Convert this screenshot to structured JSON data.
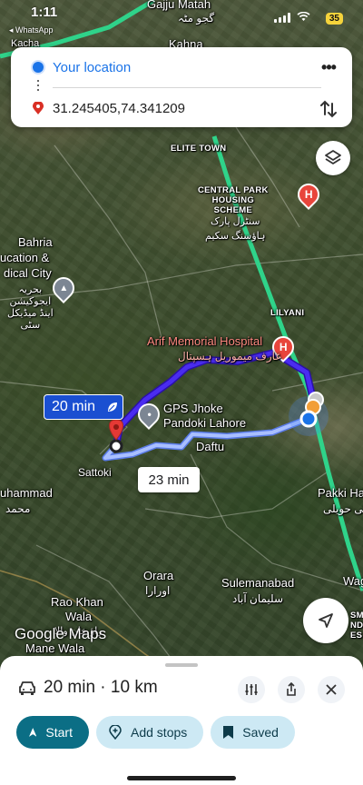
{
  "status_bar": {
    "time": "1:11",
    "back_label": "◂ WhatsApp",
    "battery": "35"
  },
  "directions": {
    "origin": "Your location",
    "destination": "31.245405,74.341209",
    "more_label": "•••"
  },
  "map": {
    "labels": {
      "kacha": "Kacha",
      "gajju_matah": "Gajju Matah",
      "gajju_matah_urdu": "گجو مٹہ",
      "kahna": "Kahna",
      "elite_town": "ELITE TOWN",
      "central_park": "CENTRAL PARK\nHOUSING\nSCHEME",
      "central_park_urdu": "سنٹرل پارک\nہاؤسنگ سکیم",
      "bahria_1": "Bahria",
      "bahria_2": "ucation &",
      "bahria_3": "dical City",
      "bahria_urdu": "بحریہ\nایجوکیشن\nاینڈ میڈیکل\nسٹی",
      "lilyani": "LILYANI",
      "arif_hospital": "Arif Memorial Hospital",
      "arif_hospital_urdu": "عارف میموریل ہسپتال",
      "gps": "GPS Jhoke\nPandoki Lahore",
      "daftu": "Daftu",
      "sattoki": "Sattoki",
      "muhammad": "uhammad",
      "muhammad_urdu": "محمد",
      "pakki": "Pakki Hav",
      "pakki_urdu": "پکی حویلی",
      "orara": "Orara",
      "orara_urdu": "اورارا",
      "sulemanabad": "Sulemanabad",
      "sulemanabad_urdu": "سلیمان آباد",
      "rao_khan_1": "Rao Khan",
      "rao_khan_2": "Wala",
      "rao_khan_urdu": "راؤ خان والا",
      "mane_wala": "Mane Wala",
      "wag": "Wag",
      "indu": "SM\nNDU\nES"
    },
    "route_main": "20 min",
    "route_alt": "23 min",
    "logo": "Google Maps",
    "colors": {
      "route_main": "#3d1fd6",
      "route_alt": "#8aa6ff",
      "highway": "#2fd38a",
      "hospital": "#e8453c"
    }
  },
  "sheet": {
    "summary": "20 min · 10 km",
    "start_label": "Start",
    "add_stops_label": "Add stops",
    "saved_label": "Saved"
  }
}
